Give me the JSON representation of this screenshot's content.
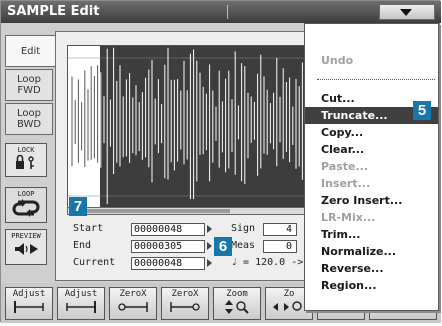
{
  "window": {
    "title": "SAMPLE Edit"
  },
  "tabs": [
    {
      "label": "Edit",
      "active": true
    },
    {
      "label": "Loop\nFWD"
    },
    {
      "label": "Loop\nBWD"
    }
  ],
  "side_buttons": {
    "lock": "LOCK",
    "loop": "LOOP",
    "preview": "PREVIEW"
  },
  "info": {
    "start_label": "Start",
    "start_value": "00000048",
    "end_label": "End",
    "end_value": "00000305",
    "current_label": "Current",
    "current_value": "00000048",
    "sign_label": "Sign",
    "sign_value": "4",
    "meas_label": "Meas",
    "meas_value": "0",
    "tempo_text": "♩ = 120.0 ->"
  },
  "toolbar": [
    {
      "label": "Adjust",
      "icon": "bracket-left-icon"
    },
    {
      "label": "Adjust",
      "icon": "bracket-right-icon"
    },
    {
      "label": "ZeroX",
      "icon": "zerox-left-icon"
    },
    {
      "label": "ZeroX",
      "icon": "zerox-right-icon"
    },
    {
      "label": "Zoom",
      "icon": "zoom-vertical-icon"
    },
    {
      "label": "Zo",
      "icon": "zoom-horizontal-icon"
    }
  ],
  "menu": {
    "items": [
      {
        "label": "Undo",
        "disabled": true
      },
      {
        "label": "Cut..."
      },
      {
        "label": "Truncate...",
        "selected": true
      },
      {
        "label": "Copy..."
      },
      {
        "label": "Clear..."
      },
      {
        "label": "Paste...",
        "disabled": true
      },
      {
        "label": "Insert...",
        "disabled": true
      },
      {
        "label": "Zero Insert..."
      },
      {
        "label": "LR-Mix...",
        "disabled": true
      },
      {
        "label": "Trim..."
      },
      {
        "label": "Normalize..."
      },
      {
        "label": "Reverse..."
      },
      {
        "label": "Region..."
      }
    ]
  },
  "badges": {
    "b5": "5",
    "b6": "6",
    "b7": "7"
  },
  "colors": {
    "badge": "#1877a8",
    "selection": "#3f3f3f",
    "title_bar": "#4a4a4a"
  }
}
